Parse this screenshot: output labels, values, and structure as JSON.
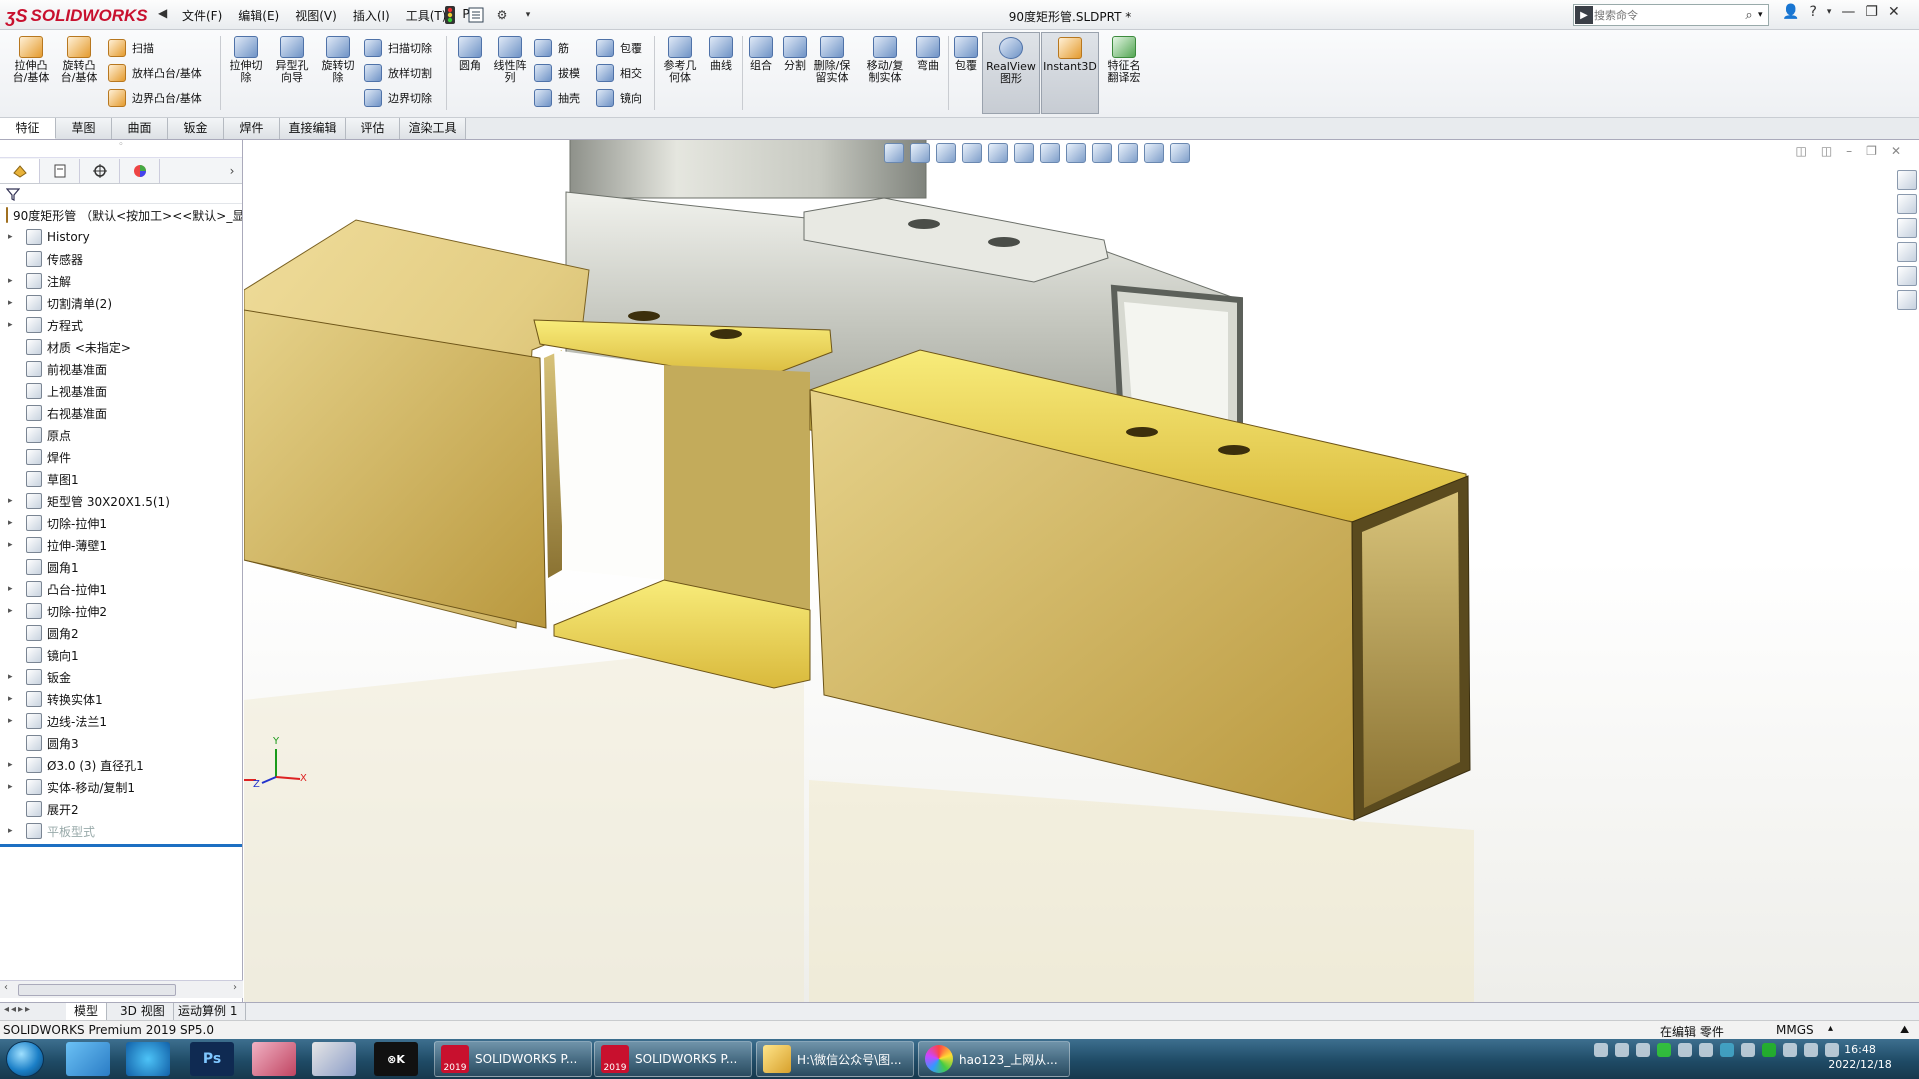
{
  "app": {
    "logo_text": "SOLIDWORKS",
    "document_title": "90度矩形管.SLDPRT *"
  },
  "menu": [
    "文件(F)",
    "编辑(E)",
    "视图(V)",
    "插入(I)",
    "工具(T)",
    "PI"
  ],
  "search": {
    "placeholder": "搜索命令"
  },
  "command_manager": {
    "large_buttons": [
      {
        "id": "extrude-boss",
        "label": "拉伸凸\n台/基体"
      },
      {
        "id": "revolve-boss",
        "label": "旋转凸\n台/基体"
      },
      {
        "id": "extrude-cut",
        "label": "拉伸切\n除"
      },
      {
        "id": "hole-wizard",
        "label": "异型孔\n向导"
      },
      {
        "id": "revolve-cut",
        "label": "旋转切\n除"
      },
      {
        "id": "fillet",
        "label": "圆角"
      },
      {
        "id": "linear-pattern",
        "label": "线性阵\n列"
      },
      {
        "id": "reference-geometry",
        "label": "参考几\n何体"
      },
      {
        "id": "curves",
        "label": "曲线"
      },
      {
        "id": "combine",
        "label": "组合"
      },
      {
        "id": "split",
        "label": "分割"
      },
      {
        "id": "delete-keep-body",
        "label": "删除/保\n留实体"
      },
      {
        "id": "move-copy-body",
        "label": "移动/复\n制实体"
      },
      {
        "id": "flex",
        "label": "弯曲"
      },
      {
        "id": "wrap-large",
        "label": "包覆"
      },
      {
        "id": "realview",
        "label": "RealView\n图形"
      },
      {
        "id": "instant3d",
        "label": "Instant3D"
      },
      {
        "id": "feature-translate",
        "label": "特征名\n翻译宏"
      }
    ],
    "small_buttons": [
      {
        "id": "sweep",
        "label": "扫描"
      },
      {
        "id": "loft",
        "label": "放样凸台/基体"
      },
      {
        "id": "boundary-boss",
        "label": "边界凸台/基体"
      },
      {
        "id": "swept-cut",
        "label": "扫描切除"
      },
      {
        "id": "lofted-cut",
        "label": "放样切割"
      },
      {
        "id": "boundary-cut",
        "label": "边界切除"
      },
      {
        "id": "rib",
        "label": "筋"
      },
      {
        "id": "draft",
        "label": "拔模"
      },
      {
        "id": "shell",
        "label": "抽壳"
      },
      {
        "id": "wrap",
        "label": "包覆"
      },
      {
        "id": "intersect",
        "label": "相交"
      },
      {
        "id": "mirror",
        "label": "镜向"
      }
    ]
  },
  "tabs": [
    "特征",
    "草图",
    "曲面",
    "钣金",
    "焊件",
    "直接编辑",
    "评估",
    "渲染工具"
  ],
  "tree": [
    {
      "label": "90度矩形管 （默认<按加工><<默认>_显",
      "expand": "",
      "root": true
    },
    {
      "label": "History",
      "expand": "▸"
    },
    {
      "label": "传感器",
      "expand": ""
    },
    {
      "label": "注解",
      "expand": "▸"
    },
    {
      "label": "切割清单(2)",
      "expand": "▸"
    },
    {
      "label": "方程式",
      "expand": "▸"
    },
    {
      "label": "材质 <未指定>",
      "expand": ""
    },
    {
      "label": "前视基准面",
      "expand": ""
    },
    {
      "label": "上视基准面",
      "expand": ""
    },
    {
      "label": "右视基准面",
      "expand": ""
    },
    {
      "label": "原点",
      "expand": ""
    },
    {
      "label": "焊件",
      "expand": ""
    },
    {
      "label": "草图1",
      "expand": ""
    },
    {
      "label": "矩型管 30X20X1.5(1)",
      "expand": "▸"
    },
    {
      "label": "切除-拉伸1",
      "expand": "▸"
    },
    {
      "label": "拉伸-薄壁1",
      "expand": "▸"
    },
    {
      "label": "圆角1",
      "expand": ""
    },
    {
      "label": "凸台-拉伸1",
      "expand": "▸"
    },
    {
      "label": "切除-拉伸2",
      "expand": "▸"
    },
    {
      "label": "圆角2",
      "expand": ""
    },
    {
      "label": "镜向1",
      "expand": ""
    },
    {
      "label": "钣金",
      "expand": "▸"
    },
    {
      "label": "转换实体1",
      "expand": "▸"
    },
    {
      "label": "边线-法兰1",
      "expand": "▸"
    },
    {
      "label": "圆角3",
      "expand": ""
    },
    {
      "label": "Ø3.0 (3) 直径孔1",
      "expand": "▸"
    },
    {
      "label": "实体-移动/复制1",
      "expand": "▸"
    },
    {
      "label": "展开2",
      "expand": ""
    },
    {
      "label": "平板型式",
      "expand": "▸",
      "dim": true
    }
  ],
  "bottom_tabs": [
    "模型",
    "3D 视图",
    "运动算例 1"
  ],
  "status": {
    "product": "SOLIDWORKS Premium 2019 SP5.0",
    "mode": "在编辑 零件",
    "units": "MMGS"
  },
  "triad": {
    "x": "X",
    "y": "Y",
    "z": "Z"
  },
  "taskbar": {
    "windows": [
      {
        "label": "SOLIDWORKS P...",
        "badge": "2019"
      },
      {
        "label": "SOLIDWORKS P...",
        "badge": "2019"
      },
      {
        "label": "H:\\微信公众号\\图...",
        "badge": ""
      },
      {
        "label": "hao123_上网从...",
        "badge": ""
      }
    ],
    "clock_time": "16:48",
    "clock_date": "2022/12/18"
  },
  "colors": {
    "brass": "#e6cc6a",
    "steel": "#c9cbc4",
    "accent": "#c8102e"
  }
}
